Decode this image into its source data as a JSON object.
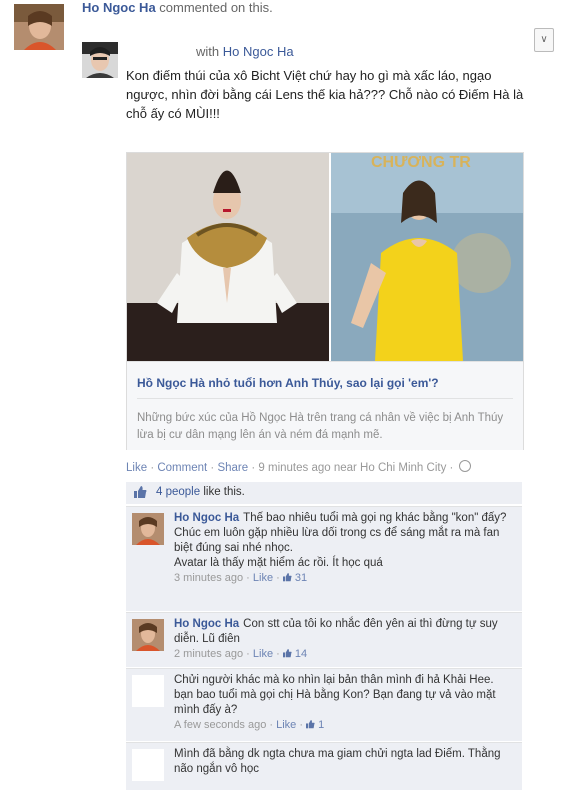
{
  "notice": {
    "actor": "Ho Ngoc Ha",
    "action": "commented on this."
  },
  "post": {
    "with_prefix": "with",
    "with_name": "Ho Ngoc Ha",
    "text": "Kon điếm thúi của xô Bicht Việt chứ hay ho gì mà xấc láo, ngạo ngược, nhìn đời bằng cái Lens thế kia hả??? Chỗ nào có Điếm Hà là chỗ ấy có MÙI!!!"
  },
  "card": {
    "title": "Hồ Ngọc Hà nhỏ tuổi hơn Anh Thúy, sao lại gọi 'em'?",
    "description": "Những bức xúc của Hồ Ngọc Hà trên trang cá nhân về việc bị Anh Thúy lừa bị cư dân mạng lên án và ném đá mạnh mẽ."
  },
  "actions": {
    "like": "Like",
    "comment": "Comment",
    "share": "Share",
    "time": "9 minutes ago near Ho Chi Minh City",
    "sep": "·"
  },
  "likes": {
    "count": "4 people",
    "suffix": "like this."
  },
  "comments": [
    {
      "name": "Ho Ngoc Ha",
      "text": "Thế bao nhiêu tuổi mà gọi ng khác bằng \"kon\" đấy?",
      "text2": "Chúc em luôn gặp nhiều lừa dối trong cs để sáng mắt ra mà fan biệt đúng sai nhé nhọc.",
      "text3": "Avatar là thấy mặt hiểm ác rồi. Ít học quá",
      "time": "3 minutes ago",
      "like": "Like",
      "count": "31"
    },
    {
      "name": "Ho Ngoc Ha",
      "text": "Con stt của tôi ko nhắc đên yên ai thì đừng tự suy diễn. Lũ điên",
      "time": "2 minutes ago",
      "like": "Like",
      "count": "14"
    },
    {
      "name": "",
      "text": "Chửi người khác mà ko nhìn lại bản thân mình đi hả Khải Hee. bạn bao tuổi mà gọi chị Hà bằng Kon? Bạn đang tự vả vào mặt mình đấy à?",
      "time": "A few seconds ago",
      "like": "Like",
      "count": "1"
    },
    {
      "name": "",
      "text": "Mình đã bằng dk ngta chưa ma giam chửi ngta lad Điếm. Thằng não ngắn vô học",
      "time": "",
      "like": "",
      "count": ""
    }
  ],
  "colors": {
    "link": "#3b5998",
    "comment_bg": "#edeff4",
    "yellow_dress": "#f3d21b"
  }
}
